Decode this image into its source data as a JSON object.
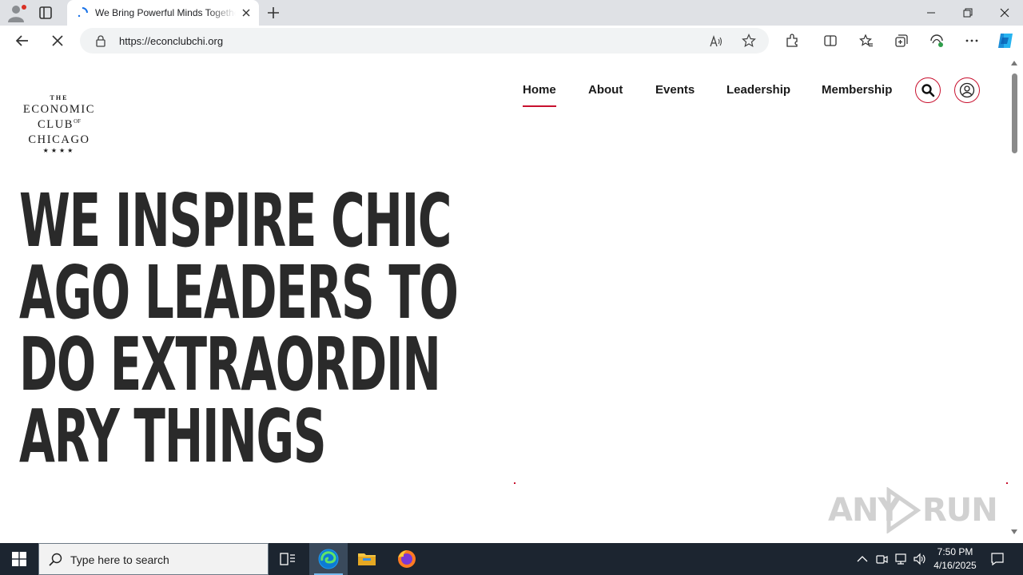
{
  "browser": {
    "tab": {
      "title": "We Bring Powerful Minds Together"
    },
    "address": {
      "url": "https://econclubchi.org"
    }
  },
  "site": {
    "logo": {
      "the": "THE",
      "line1": "ECONOMIC",
      "line2a": "CLUB",
      "line2b": "OF",
      "line3": "CHICAGO",
      "stars": "★★★★"
    },
    "nav": [
      {
        "label": "Home",
        "active": true
      },
      {
        "label": "About"
      },
      {
        "label": "Events"
      },
      {
        "label": "Leadership"
      },
      {
        "label": "Membership"
      }
    ],
    "hero": {
      "headline": "WE INSPIRE CHICAGO LEADERS TO DO EXTRAORDINARY THINGS"
    },
    "accent_color": "#c8102e"
  },
  "watermark": {
    "left": "ANY",
    "right": "RUN"
  },
  "taskbar": {
    "search_placeholder": "Type here to search",
    "time": "7:50 PM",
    "date": "4/16/2025"
  }
}
